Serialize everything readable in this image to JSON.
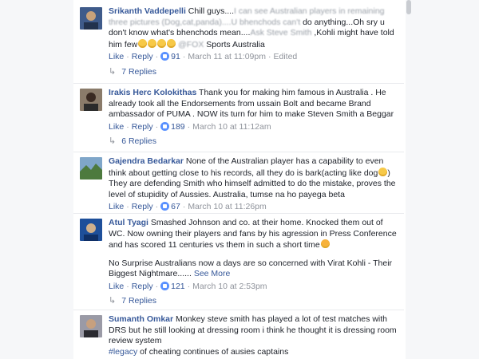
{
  "comments": [
    {
      "author": "Srikanth Vaddepelli",
      "text_parts": [
        "Chill guys....",
        "I can see Australian players in remaining three pictures (Dog,cat,panda)....U bhenchods can't",
        " do anything...Oh sry u don't know what's bhenchods mean....",
        "Ask Steve Smith",
        " ,Kohli might have told him few",
        "@FOX",
        " Sports Australia"
      ],
      "like": "Like",
      "reply": "Reply",
      "likes": "91",
      "time": "March 11 at 11:09pm",
      "edited": "Edited",
      "replies": "7 Replies",
      "avatar_color": "#3f5b8a"
    },
    {
      "author": "Irakis Herc Kolokithas",
      "text": "Thank you for making him famous in Australia . He already took all the Endorsements from ussain Bolt and became Brand ambassador of PUMA . NOW its turn for him to make Steven Smith a Beggar",
      "like": "Like",
      "reply": "Reply",
      "likes": "189",
      "time": "March 10 at 11:12am",
      "replies": "6 Replies",
      "avatar_color": "#6b5a4a"
    },
    {
      "author": "Gajendra Bedarkar",
      "text_a": "None of the Australian player has a capability to even think about getting close to his records, all they do is bark(acting like dog",
      "text_b": ") They are defending Smith who himself admitted to do the mistake, proves the level of stupidity of Aussies. Australia, tumse na ho payega beta",
      "like": "Like",
      "reply": "Reply",
      "likes": "67",
      "time": "March 10 at 11:26pm",
      "avatar_color": "#5c7a4e"
    },
    {
      "author": "Atul Tyagi",
      "text_a": "Smashed Johnson and co. at their home. Knocked them out of WC. Now owning their players and fans by his agression in Press Conference and has scored 11 centuries vs them in such a short time",
      "text_c": "No Surprise Australians now a days are so concerned with Virat Kohli - Their Biggest Nightmare......",
      "see_more": "See More",
      "like": "Like",
      "reply": "Reply",
      "likes": "121",
      "time": "March 10 at 2:53pm",
      "replies": "7 Replies",
      "avatar_color": "#2d5a9c"
    },
    {
      "author": "Sumanth Omkar",
      "text": "Monkey steve smith has played a lot of test matches with DRS but he still looking at dressing room i think he thought it is dressing room review system",
      "hashtag": "#legacy",
      "text_d": " of cheating continues of ausies captains",
      "avatar_color": "#4a4a52"
    }
  ],
  "sep": "·"
}
